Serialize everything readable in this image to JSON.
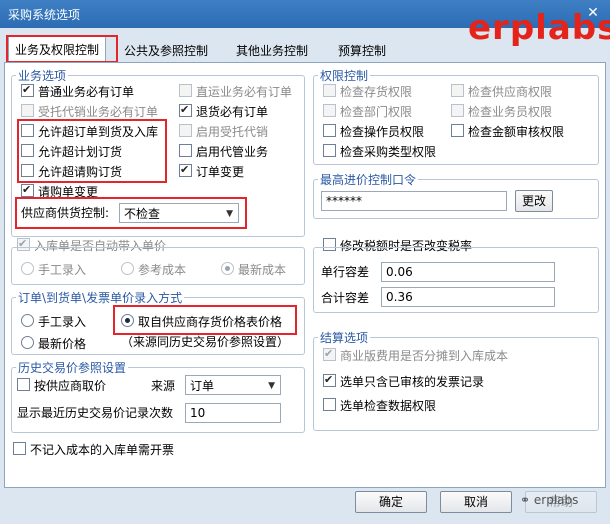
{
  "window": {
    "title": "采购系统选项",
    "close_glyph": "✕"
  },
  "watermark": "erplabs",
  "tabs": [
    "业务及权限控制",
    "公共及参照控制",
    "其他业务控制",
    "预算控制"
  ],
  "business": {
    "legend": "业务选项",
    "left": [
      {
        "label": "普通业务必有订单",
        "checked": true,
        "disabled": false
      },
      {
        "label": "受托代销业务必有订单",
        "checked": false,
        "disabled": true
      },
      {
        "label": "允许超订单到货及入库",
        "checked": false,
        "disabled": false
      },
      {
        "label": "允许超计划订货",
        "checked": false,
        "disabled": false
      },
      {
        "label": "允许超请购订货",
        "checked": false,
        "disabled": false
      },
      {
        "label": "请购单变更",
        "checked": true,
        "disabled": false
      }
    ],
    "right": [
      {
        "label": "直运业务必有订单",
        "checked": false,
        "disabled": true
      },
      {
        "label": "退货必有订单",
        "checked": true,
        "disabled": false
      },
      {
        "label": "启用受托代销",
        "checked": false,
        "disabled": true
      },
      {
        "label": "启用代管业务",
        "checked": false,
        "disabled": false
      },
      {
        "label": "订单变更",
        "checked": true,
        "disabled": false
      }
    ],
    "supplier_label": "供应商供货控制:",
    "supplier_value": "不检查"
  },
  "warehouse": {
    "label": "入库单是否自动带入单价",
    "options": [
      "手工录入",
      "参考成本",
      "最新成本"
    ]
  },
  "price_entry": {
    "legend": "订单\\到货单\\发票单价录入方式",
    "options": [
      "手工录入",
      "最新价格",
      "取自供应商存货价格表价格"
    ],
    "note": "（来源同历史交易价参照设置）"
  },
  "history": {
    "legend": "历史交易价参照设置",
    "by_supplier": "按供应商取价",
    "source_label": "来源",
    "source_value": "订单",
    "count_label": "显示最近历史交易价记录次数",
    "count_value": "10"
  },
  "not_cost": "不记入成本的入库单需开票",
  "permission": {
    "legend": "权限控制",
    "items": [
      {
        "label": "检查存货权限",
        "checked": false,
        "disabled": true
      },
      {
        "label": "检查供应商权限",
        "checked": false,
        "disabled": true
      },
      {
        "label": "检查部门权限",
        "checked": false,
        "disabled": true
      },
      {
        "label": "检查业务员权限",
        "checked": false,
        "disabled": true
      },
      {
        "label": "检查操作员权限",
        "checked": false,
        "disabled": false
      },
      {
        "label": "检查金额审核权限",
        "checked": false,
        "disabled": false
      },
      {
        "label": "检查采购类型权限",
        "checked": false,
        "disabled": false
      }
    ]
  },
  "max_price": {
    "legend": "最高进价控制口令",
    "password": "******",
    "change_button": "更改"
  },
  "tax": {
    "label": "修改税额时是否改变税率",
    "line_label": "单行容差",
    "line_value": "0.06",
    "total_label": "合计容差",
    "total_value": "0.36"
  },
  "settlement": {
    "legend": "结算选项",
    "items": [
      {
        "label": "商业版费用是否分摊到入库成本",
        "checked": true,
        "disabled": true
      },
      {
        "label": "选单只含已审核的发票记录",
        "checked": true,
        "disabled": false
      },
      {
        "label": "选单检查数据权限",
        "checked": false,
        "disabled": false
      }
    ]
  },
  "footer": {
    "ok": "确定",
    "cancel": "取消",
    "help": "帮助",
    "wechat": "erplabs"
  }
}
